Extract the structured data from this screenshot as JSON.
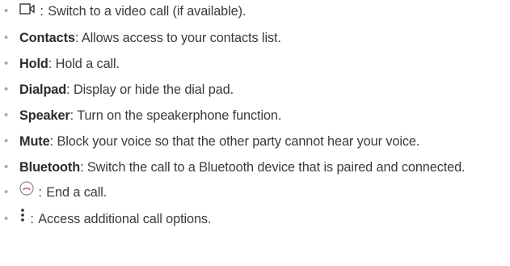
{
  "items": [
    {
      "icon": "video-call-icon",
      "separator": " : ",
      "desc": "Switch to a video call (if available)."
    },
    {
      "term": "Contacts",
      "separator": ": ",
      "desc": "Allows access to your contacts list."
    },
    {
      "term": "Hold",
      "separator": ": ",
      "desc": "Hold a call."
    },
    {
      "term": "Dialpad",
      "separator": ": ",
      "desc": "Display or hide the dial pad."
    },
    {
      "term": "Speaker",
      "separator": ": ",
      "desc": "Turn on the speakerphone function."
    },
    {
      "term": "Mute",
      "separator": ": ",
      "desc": "Block your voice so that the other party cannot hear your voice."
    },
    {
      "term": "Bluetooth",
      "separator": ": ",
      "desc": "Switch the call to a Bluetooth device that is paired and connected."
    },
    {
      "icon": "end-call-icon",
      "separator": " : ",
      "desc": "End a call."
    },
    {
      "icon": "more-options-icon",
      "separator": " : ",
      "desc": "Access additional call options."
    }
  ],
  "colors": {
    "text": "#3a3a3a",
    "term": "#2c2c2c",
    "bullet": "#a8a8a8",
    "end_call": "#e0394a"
  }
}
